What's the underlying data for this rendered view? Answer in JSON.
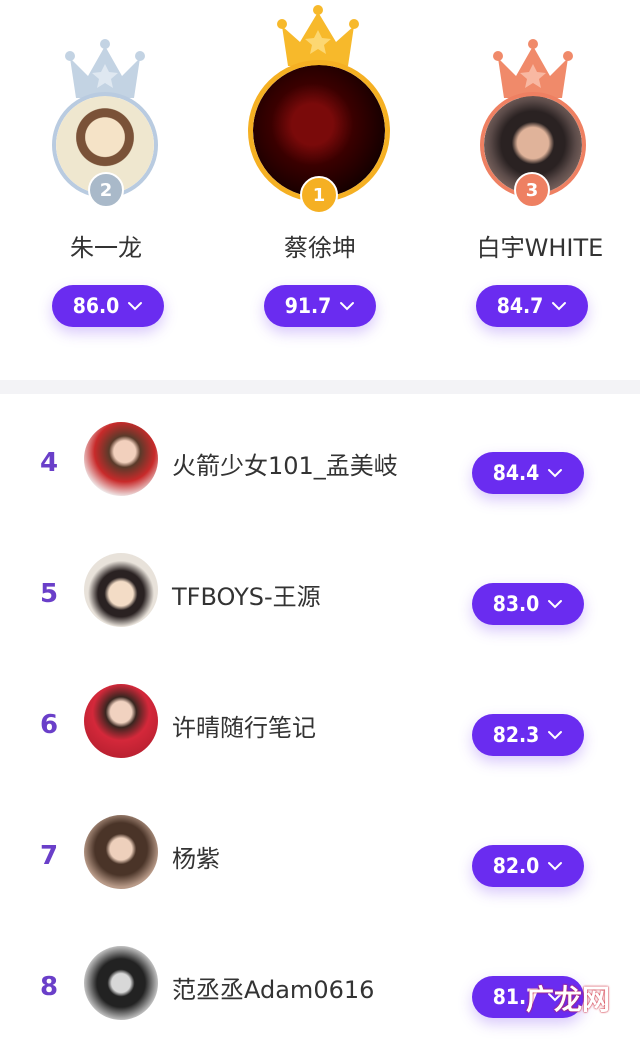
{
  "podium": [
    {
      "rank": "2",
      "name": "朱一龙",
      "score": "86.0",
      "crown_color": "#b9cde0",
      "badge_color": "#a9b9c9"
    },
    {
      "rank": "1",
      "name": "蔡徐坤",
      "score": "91.7",
      "crown_color": "#f7b92b",
      "badge_color": "#f5b023"
    },
    {
      "rank": "3",
      "name": "白宇WHITE",
      "score": "84.7",
      "crown_color": "#f08a6a",
      "badge_color": "#ee8062"
    }
  ],
  "list": [
    {
      "rank": "4",
      "name": "火箭少女101_孟美岐",
      "score": "84.4"
    },
    {
      "rank": "5",
      "name": "TFBOYS-王源",
      "score": "83.0"
    },
    {
      "rank": "6",
      "name": "许晴随行笔记",
      "score": "82.3"
    },
    {
      "rank": "7",
      "name": "杨紫",
      "score": "82.0"
    },
    {
      "rank": "8",
      "name": "范丞丞Adam0616",
      "score": "81.7"
    }
  ],
  "watermark": "广龙网",
  "colors": {
    "accent": "#6a2cf0",
    "rank_number": "#6a3fc9",
    "divider": "#f3f3f6"
  }
}
